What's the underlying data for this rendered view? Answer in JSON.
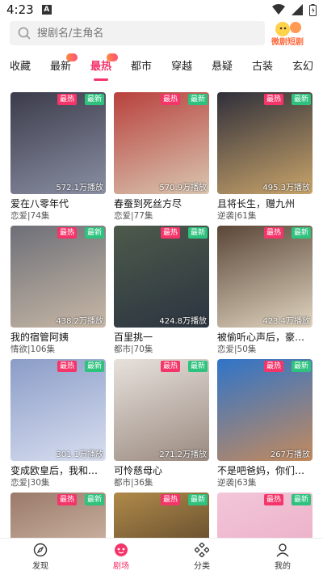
{
  "status_bar": {
    "time": "4:23",
    "notif_letter": "A"
  },
  "search": {
    "placeholder": "搜剧名/主角名",
    "brand_logo_text": "微剧短剧"
  },
  "tabs": [
    {
      "label": "收藏"
    },
    {
      "label": "最新"
    },
    {
      "label": "最热"
    },
    {
      "label": "都市"
    },
    {
      "label": "穿越"
    },
    {
      "label": "悬疑"
    },
    {
      "label": "古装"
    },
    {
      "label": "玄幻"
    }
  ],
  "active_tab": "最热",
  "badges": {
    "hot": "最热",
    "new": "最新"
  },
  "cards": [
    {
      "title": "爱在八零年代",
      "meta": "恋爱|74集",
      "plays": "572.1万播放",
      "colors": [
        "#3b3b4a",
        "#8a8fa3"
      ]
    },
    {
      "title": "春蚕到死丝方尽",
      "meta": "恋爱|77集",
      "plays": "570.9万播放",
      "colors": [
        "#b8413d",
        "#d9c6b0"
      ]
    },
    {
      "title": "且将长生，赠九州",
      "meta": "逆袭|61集",
      "plays": "495.3万播放",
      "colors": [
        "#2f2f3a",
        "#c9a46a"
      ]
    },
    {
      "title": "我的宿管阿姨",
      "meta": "情欲|106集",
      "plays": "438.2万播放",
      "colors": [
        "#6d6f78",
        "#c8b8a6"
      ]
    },
    {
      "title": "百里挑一",
      "meta": "都市|70集",
      "plays": "424.8万播放",
      "colors": [
        "#4d5a4b",
        "#2b3440"
      ]
    },
    {
      "title": "被偷听心声后，豪门...",
      "meta": "恋爱|50集",
      "plays": "423.4万播放",
      "colors": [
        "#5a4637",
        "#e0d4c0"
      ]
    },
    {
      "title": "变成欧皇后，我和陆...",
      "meta": "恋爱|30集",
      "plays": "301.1万播放",
      "colors": [
        "#8a9cc7",
        "#d9dff0"
      ]
    },
    {
      "title": "可怜慈母心",
      "meta": "都市|36集",
      "plays": "271.2万播放",
      "colors": [
        "#e7e1dc",
        "#9a8a80"
      ]
    },
    {
      "title": "不是吧爸妈，你们真...",
      "meta": "逆袭|63集",
      "plays": "267万播放",
      "colors": [
        "#2f74c9",
        "#c48a5d"
      ]
    },
    {
      "title": "",
      "meta": "",
      "plays": "",
      "colors": [
        "#9a7a6a",
        "#e6d0c0"
      ]
    },
    {
      "title": "",
      "meta": "",
      "plays": "",
      "colors": [
        "#b08a4a",
        "#3d2d1e"
      ]
    },
    {
      "title": "",
      "meta": "",
      "plays": "",
      "colors": [
        "#f2c6d8",
        "#e9a6c0"
      ]
    }
  ],
  "bottom_nav": [
    {
      "label": "发现",
      "icon": "compass-icon"
    },
    {
      "label": "剧场",
      "icon": "theater-icon"
    },
    {
      "label": "分类",
      "icon": "category-icon"
    },
    {
      "label": "我的",
      "icon": "user-icon"
    }
  ],
  "colors": {
    "accent": "#f4356a",
    "new_badge": "#2ec27e"
  }
}
